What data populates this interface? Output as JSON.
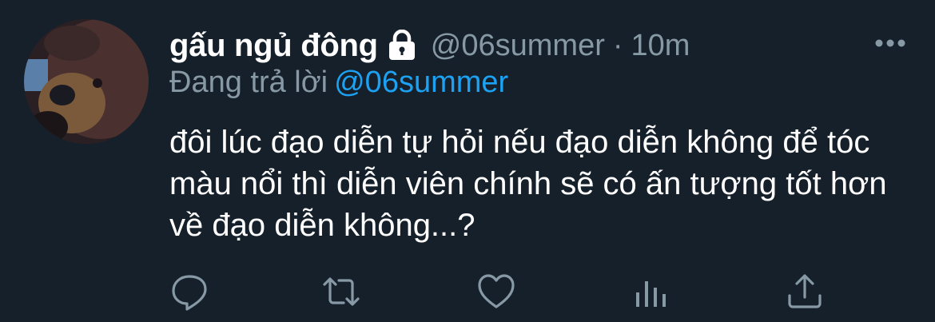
{
  "tweet": {
    "display_name": "gấu ngủ đông",
    "handle": "@06summer",
    "separator": "·",
    "time": "10m",
    "reply_prefix": "Đang trả lời",
    "reply_mention": "@06summer",
    "text": "đôi lúc đạo diễn tự hỏi nếu đạo diễn không để tóc màu nổi thì diễn viên chính sẽ có ấn tượng tốt hơn về đạo diễn không...?",
    "protected": true
  },
  "icons": {
    "lock": "lock-icon",
    "more": "more-icon",
    "reply": "reply-icon",
    "retweet": "retweet-icon",
    "like": "like-icon",
    "analytics": "analytics-icon",
    "share": "share-icon"
  },
  "colors": {
    "background": "#15202b",
    "text": "#ffffff",
    "muted": "#8899a6",
    "accent": "#1da1f2"
  }
}
